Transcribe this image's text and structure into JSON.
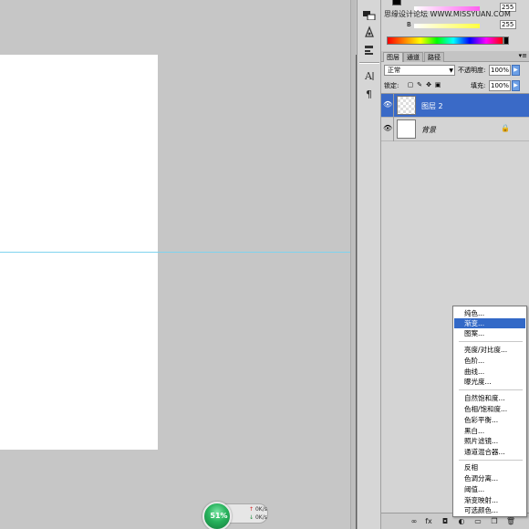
{
  "color_panel": {
    "watermark": "思缘设计论坛  WWW.MISSYUAN.COM",
    "sliders": [
      {
        "label": "",
        "value": "255",
        "color": "#ff5ff0"
      },
      {
        "label": "B",
        "value": "255",
        "color": "#ffff40"
      }
    ]
  },
  "layers_panel": {
    "tabs": [
      "图层",
      "通道",
      "路径"
    ],
    "menu_glyph": "▾≡",
    "blend_mode": "正常",
    "opacity_label": "不透明度:",
    "opacity_value": "100%",
    "lock_label": "锁定:",
    "fill_label": "填充:",
    "fill_value": "100%",
    "layers": [
      {
        "name": "图层 2",
        "selected": true,
        "italic": false,
        "thumbnail": "transparent"
      },
      {
        "name": "背景",
        "selected": false,
        "italic": true,
        "thumbnail": "white",
        "locked": true
      }
    ]
  },
  "adjustment_menu": {
    "groups": [
      [
        "纯色...",
        "渐变...",
        "图案..."
      ],
      [
        "亮度/对比度...",
        "色阶...",
        "曲线...",
        "曝光度..."
      ],
      [
        "自然饱和度...",
        "色相/饱和度...",
        "色彩平衡...",
        "黑白...",
        "照片滤镜...",
        "通道混合器..."
      ],
      [
        "反相",
        "色调分离...",
        "阈值...",
        "渐变映射...",
        "可选颜色..."
      ]
    ],
    "highlighted": "渐变..."
  },
  "net_widget": {
    "percent": "51%",
    "up": "0K/s",
    "down": "0K/s"
  },
  "colors": {
    "selection": "#3a6ac7",
    "guide": "#7fd3ee",
    "canvas_bg": "#c6c6c6",
    "document": "#ffffff"
  }
}
